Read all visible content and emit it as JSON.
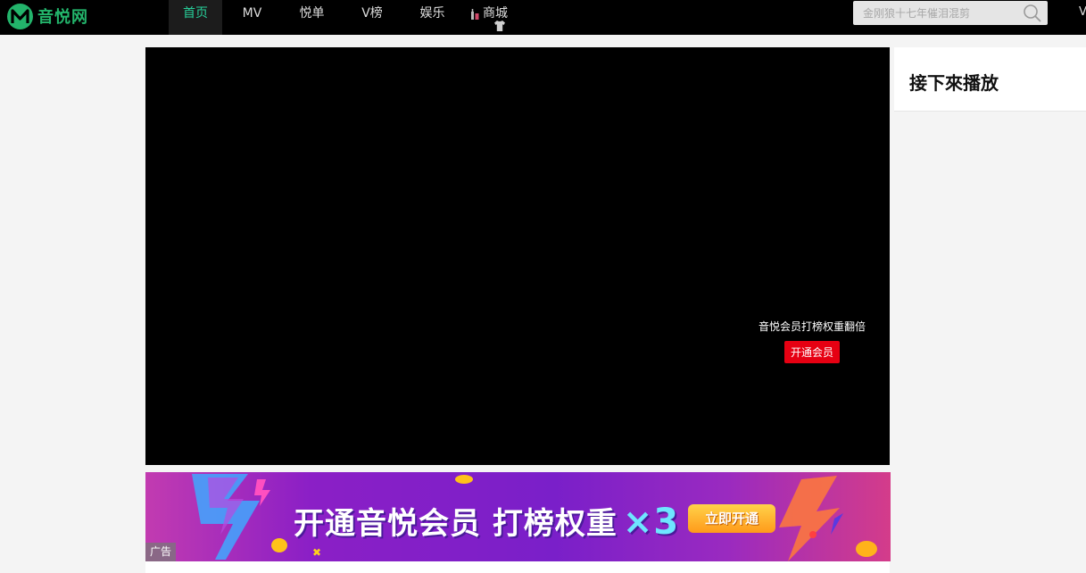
{
  "header": {
    "logo_text": "音悦网",
    "nav": [
      {
        "label": "首页",
        "active": true
      },
      {
        "label": "MV"
      },
      {
        "label": "悦单"
      },
      {
        "label": "V榜"
      },
      {
        "label": "娱乐"
      },
      {
        "label": "商城"
      }
    ],
    "search": {
      "placeholder": "金刚狼十七年催泪混剪"
    },
    "right_link": "V"
  },
  "player": {
    "vip_text": "音悦会员打榜权重翻倍",
    "vip_button": "开通会员"
  },
  "banner": {
    "title": "开通音悦会员 打榜权重",
    "multiplier": "×3",
    "cta": "立即开通",
    "ad_label": "广告"
  },
  "sidebar": {
    "up_next_title": "接下來播放"
  },
  "colors": {
    "accent": "#27d09a",
    "logo": "#23b46b",
    "vip_red": "#e60012",
    "topbar": "#000000"
  }
}
